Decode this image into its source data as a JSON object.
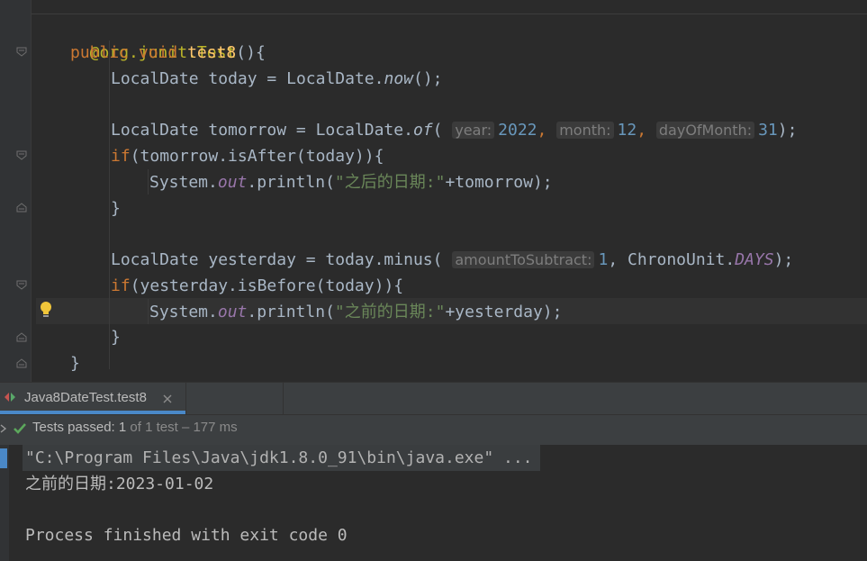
{
  "editor": {
    "annotation": "@org.junit.Test",
    "method_decl": {
      "kw_public": "public",
      "kw_void": "void",
      "name": "test8",
      "tail": "(){"
    },
    "line_today": {
      "type": "LocalDate",
      "var": "today",
      "eq": "=",
      "cls": "LocalDate.",
      "call": "now",
      "tail": "();"
    },
    "line_tomorrow": {
      "pre": "LocalDate tomorrow = LocalDate.",
      "call": "of",
      "open": "(",
      "hint_year": "year:",
      "val_year": "2022",
      "hint_month": "month:",
      "val_month": "12",
      "hint_day": "dayOfMonth:",
      "val_day": "31",
      "close": ");"
    },
    "line_if_after": {
      "kw": "if",
      "rest": "(tomorrow.isAfter(today)){"
    },
    "line_print_after": {
      "pre": "System.",
      "out": "out",
      "mid": ".println(",
      "str": "\"之后的日期:\"",
      "rest": "+tomorrow);"
    },
    "brace_close_1": "}",
    "line_yesterday": {
      "pre": "LocalDate yesterday = today.minus(",
      "hint": "amountToSubtract:",
      "val": "1",
      "mid": ", ChronoUnit.",
      "const": "DAYS",
      "close": ");"
    },
    "line_if_before": {
      "kw": "if",
      "rest": "(yesterday.isBefore(today)){"
    },
    "line_print_before": {
      "pre": "System.",
      "out": "out",
      "mid": ".println(",
      "str": "\"之前的日期:\"",
      "rest": "+yesterday);"
    },
    "brace_close_2": "}",
    "brace_close_method": "}"
  },
  "run_panel": {
    "tab_label": "Java8DateTest.test8",
    "status_prefix": "Tests passed:",
    "status_count": "1",
    "status_suffix": "of 1 test – 177 ms",
    "console_lines": [
      "\"C:\\Program Files\\Java\\jdk1.8.0_91\\bin\\java.exe\" ...",
      "之前的日期:2023-01-02",
      "",
      "Process finished with exit code 0"
    ]
  },
  "colors": {
    "keyword": "#cc7832",
    "string": "#6a8759",
    "number": "#6897bb",
    "function": "#ffc66d",
    "annotation": "#bbb529",
    "static": "#9876aa",
    "pass": "#5ca85c",
    "tab_accent": "#4a88c7"
  },
  "icons": [
    "fold-marker-icon",
    "lightbulb-icon",
    "run-config-icon",
    "close-icon",
    "expand-icon",
    "checkmark-icon"
  ]
}
